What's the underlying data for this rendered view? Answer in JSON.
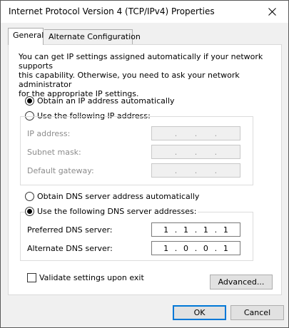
{
  "window": {
    "title": "Internet Protocol Version 4 (TCP/IPv4) Properties"
  },
  "tabs": [
    {
      "label": "General",
      "active": true
    },
    {
      "label": "Alternate Configuration",
      "active": false
    }
  ],
  "description": "You can get IP settings assigned automatically if your network supports\nthis capability. Otherwise, you need to ask your network administrator\nfor the appropriate IP settings.",
  "ip_settings": {
    "auto_label": "Obtain an IP address automatically",
    "auto_selected": true,
    "manual_label": "Use the following IP address:",
    "manual_selected": false,
    "fields": [
      {
        "label": "IP address:",
        "value": [
          "",
          "",
          "",
          ""
        ]
      },
      {
        "label": "Subnet mask:",
        "value": [
          "",
          "",
          "",
          ""
        ]
      },
      {
        "label": "Default gateway:",
        "value": [
          "",
          "",
          "",
          ""
        ]
      }
    ]
  },
  "dns_settings": {
    "auto_label": "Obtain DNS server address automatically",
    "auto_selected": false,
    "manual_label": "Use the following DNS server addresses:",
    "manual_selected": true,
    "preferred": {
      "label": "Preferred DNS server:",
      "octets": [
        "1",
        "1",
        "1",
        "1"
      ]
    },
    "alternate": {
      "label": "Alternate DNS server:",
      "octets": [
        "1",
        "0",
        "0",
        "1"
      ]
    }
  },
  "validate": {
    "label": "Validate settings upon exit",
    "checked": false
  },
  "buttons": {
    "advanced": "Advanced...",
    "ok": "OK",
    "cancel": "Cancel"
  },
  "colors": {
    "accent": "#0078d7",
    "window_bg": "#f0f0f0",
    "panel_bg": "#ffffff",
    "disabled_text": "#8c8c8c"
  },
  "icons": {
    "close": "close-icon"
  }
}
